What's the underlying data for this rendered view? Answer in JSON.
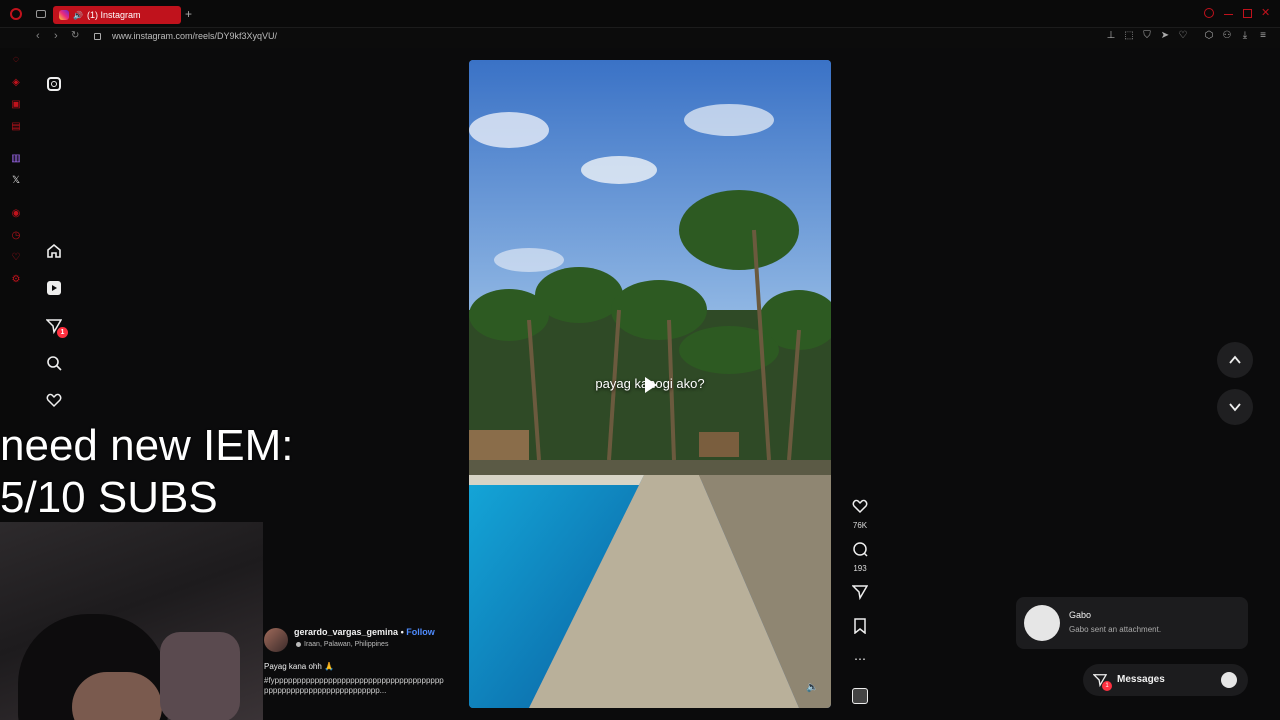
{
  "browser": {
    "tab_title": "(1) Instagram",
    "url": "www.instagram.com/reels/DY9kf3XyqVU/"
  },
  "stream_overlay": {
    "line1": "need new IEM:",
    "line2": "5/10 SUBS"
  },
  "reel": {
    "caption_overlay": "payag kanogi ako?",
    "likes": "76K",
    "comments": "193"
  },
  "post": {
    "author": "gerardo_vargas_gemina",
    "separator": " • ",
    "follow_label": "Follow",
    "location": "Iraan, Palawan, Philippines",
    "description": "Payag kana ohh 🙏",
    "hashtags": "#fypppppppppppppppppppppppppppppppppppppppppppppppppppppppppppppppp..."
  },
  "notification": {
    "sender": "Gabo",
    "message": "Gabo sent an attachment."
  },
  "messages": {
    "label": "Messages",
    "badge": "1"
  },
  "sidebar": {
    "notifications_badge": "1"
  },
  "colors": {
    "opera_red": "#c0121c",
    "ig_badge": "#ff3040",
    "follow_blue": "#4f8cff"
  }
}
